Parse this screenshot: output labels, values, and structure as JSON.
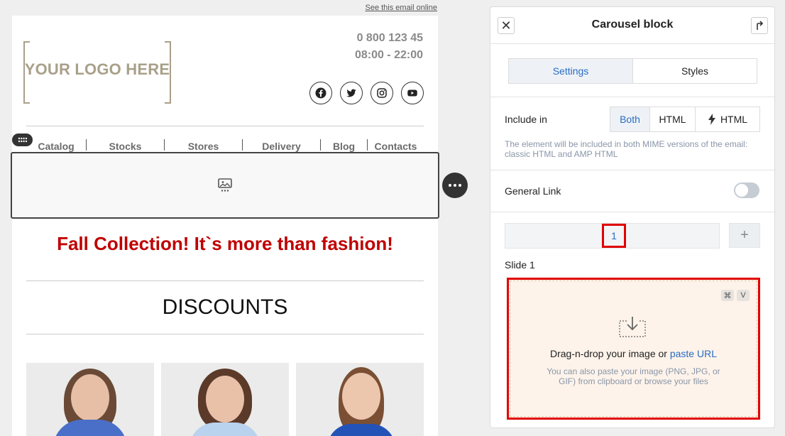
{
  "email": {
    "see_online": "See this email online",
    "logo_text": "YOUR LOGO HERE",
    "phone": "0 800 123 45",
    "hours": "08:00 - 22:00",
    "socials": [
      "facebook-icon",
      "twitter-icon",
      "instagram-icon",
      "youtube-icon"
    ],
    "menu": [
      "Catalog",
      "Stocks",
      "Stores",
      "Delivery",
      "Blog",
      "Contacts"
    ],
    "headline": "Fall Collection! It`s more than fashion!",
    "section_title": "DISCOUNTS"
  },
  "panel": {
    "title": "Carousel block",
    "tabs": [
      {
        "label": "Settings",
        "active": true
      },
      {
        "label": "Styles",
        "active": false
      }
    ],
    "include_in": {
      "label": "Include in",
      "options": [
        "Both",
        "HTML",
        "HTML"
      ],
      "selected": "Both",
      "note": "The element will be included in both MIME versions of the email: classic HTML and AMP HTML"
    },
    "general_link": {
      "label": "General Link",
      "enabled": false
    },
    "slides": {
      "tabs": [
        "1"
      ],
      "add_label": "+"
    },
    "slide_label": "Slide 1",
    "dropzone": {
      "kbd": [
        "⌘",
        "V"
      ],
      "text": "Drag-n-drop your image or ",
      "link": "paste URL",
      "hint": "You can also paste your image (PNG, JPG, or GIF) from clipboard or browse your files"
    }
  },
  "colors": {
    "accent": "#2a6cc4",
    "headline": "#c00000",
    "highlight": "#e00000",
    "dropzone_bg": "#fdf3ea"
  }
}
